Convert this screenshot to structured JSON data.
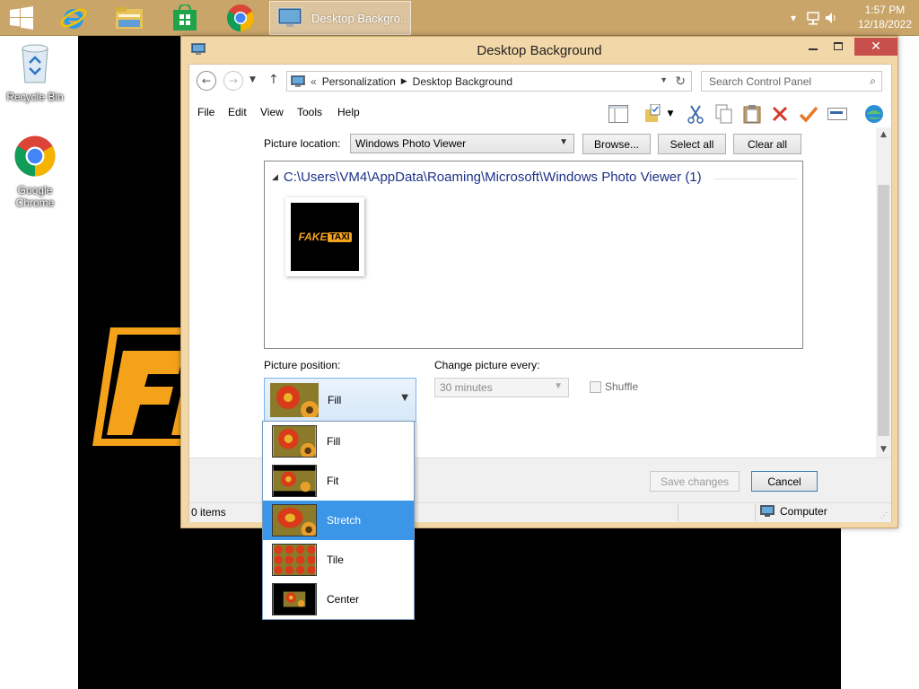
{
  "taskbar": {
    "active_window_title": "Desktop Backgro...",
    "time": "1:57 PM",
    "date": "12/18/2022",
    "icons": [
      "windows-logo-icon",
      "internet-explorer-icon",
      "file-explorer-icon",
      "store-icon",
      "chrome-icon"
    ]
  },
  "desktop": {
    "icons": [
      {
        "label": "Recycle Bin"
      },
      {
        "label": "Google Chrome"
      }
    ]
  },
  "window": {
    "title": "Desktop Background",
    "address": {
      "prefix": "«",
      "crumbs": [
        "Personalization",
        "Desktop Background"
      ]
    },
    "search_placeholder": "Search Control Panel",
    "menu": [
      "File",
      "Edit",
      "View",
      "Tools",
      "Help"
    ],
    "picture_location": {
      "label": "Picture location:",
      "value": "Windows Photo Viewer",
      "browse": "Browse...",
      "select_all": "Select all",
      "clear_all": "Clear all"
    },
    "gallery": {
      "group_header": "C:\\Users\\VM4\\AppData\\Roaming\\Microsoft\\Windows Photo Viewer (1)",
      "thumbnail_text": {
        "fake": "FAKE",
        "taxi": "TAXI"
      }
    },
    "picture_position": {
      "label": "Picture position:",
      "value": "Fill",
      "options": [
        "Fill",
        "Fit",
        "Stretch",
        "Tile",
        "Center"
      ],
      "highlighted": "Stretch"
    },
    "change_picture": {
      "label": "Change picture every:",
      "value": "30 minutes"
    },
    "shuffle": {
      "label": "Shuffle",
      "checked": false
    },
    "buttons": {
      "save": "Save changes",
      "cancel": "Cancel"
    },
    "status": {
      "items": "0 items",
      "location": "Computer"
    }
  },
  "colors": {
    "taskbar": "#c9a56a",
    "window_frame": "#f2d8a8",
    "close_button": "#c7504c",
    "selection": "#3b96e8",
    "link_blue": "#1e3287",
    "logo_orange": "#f5a21b"
  }
}
